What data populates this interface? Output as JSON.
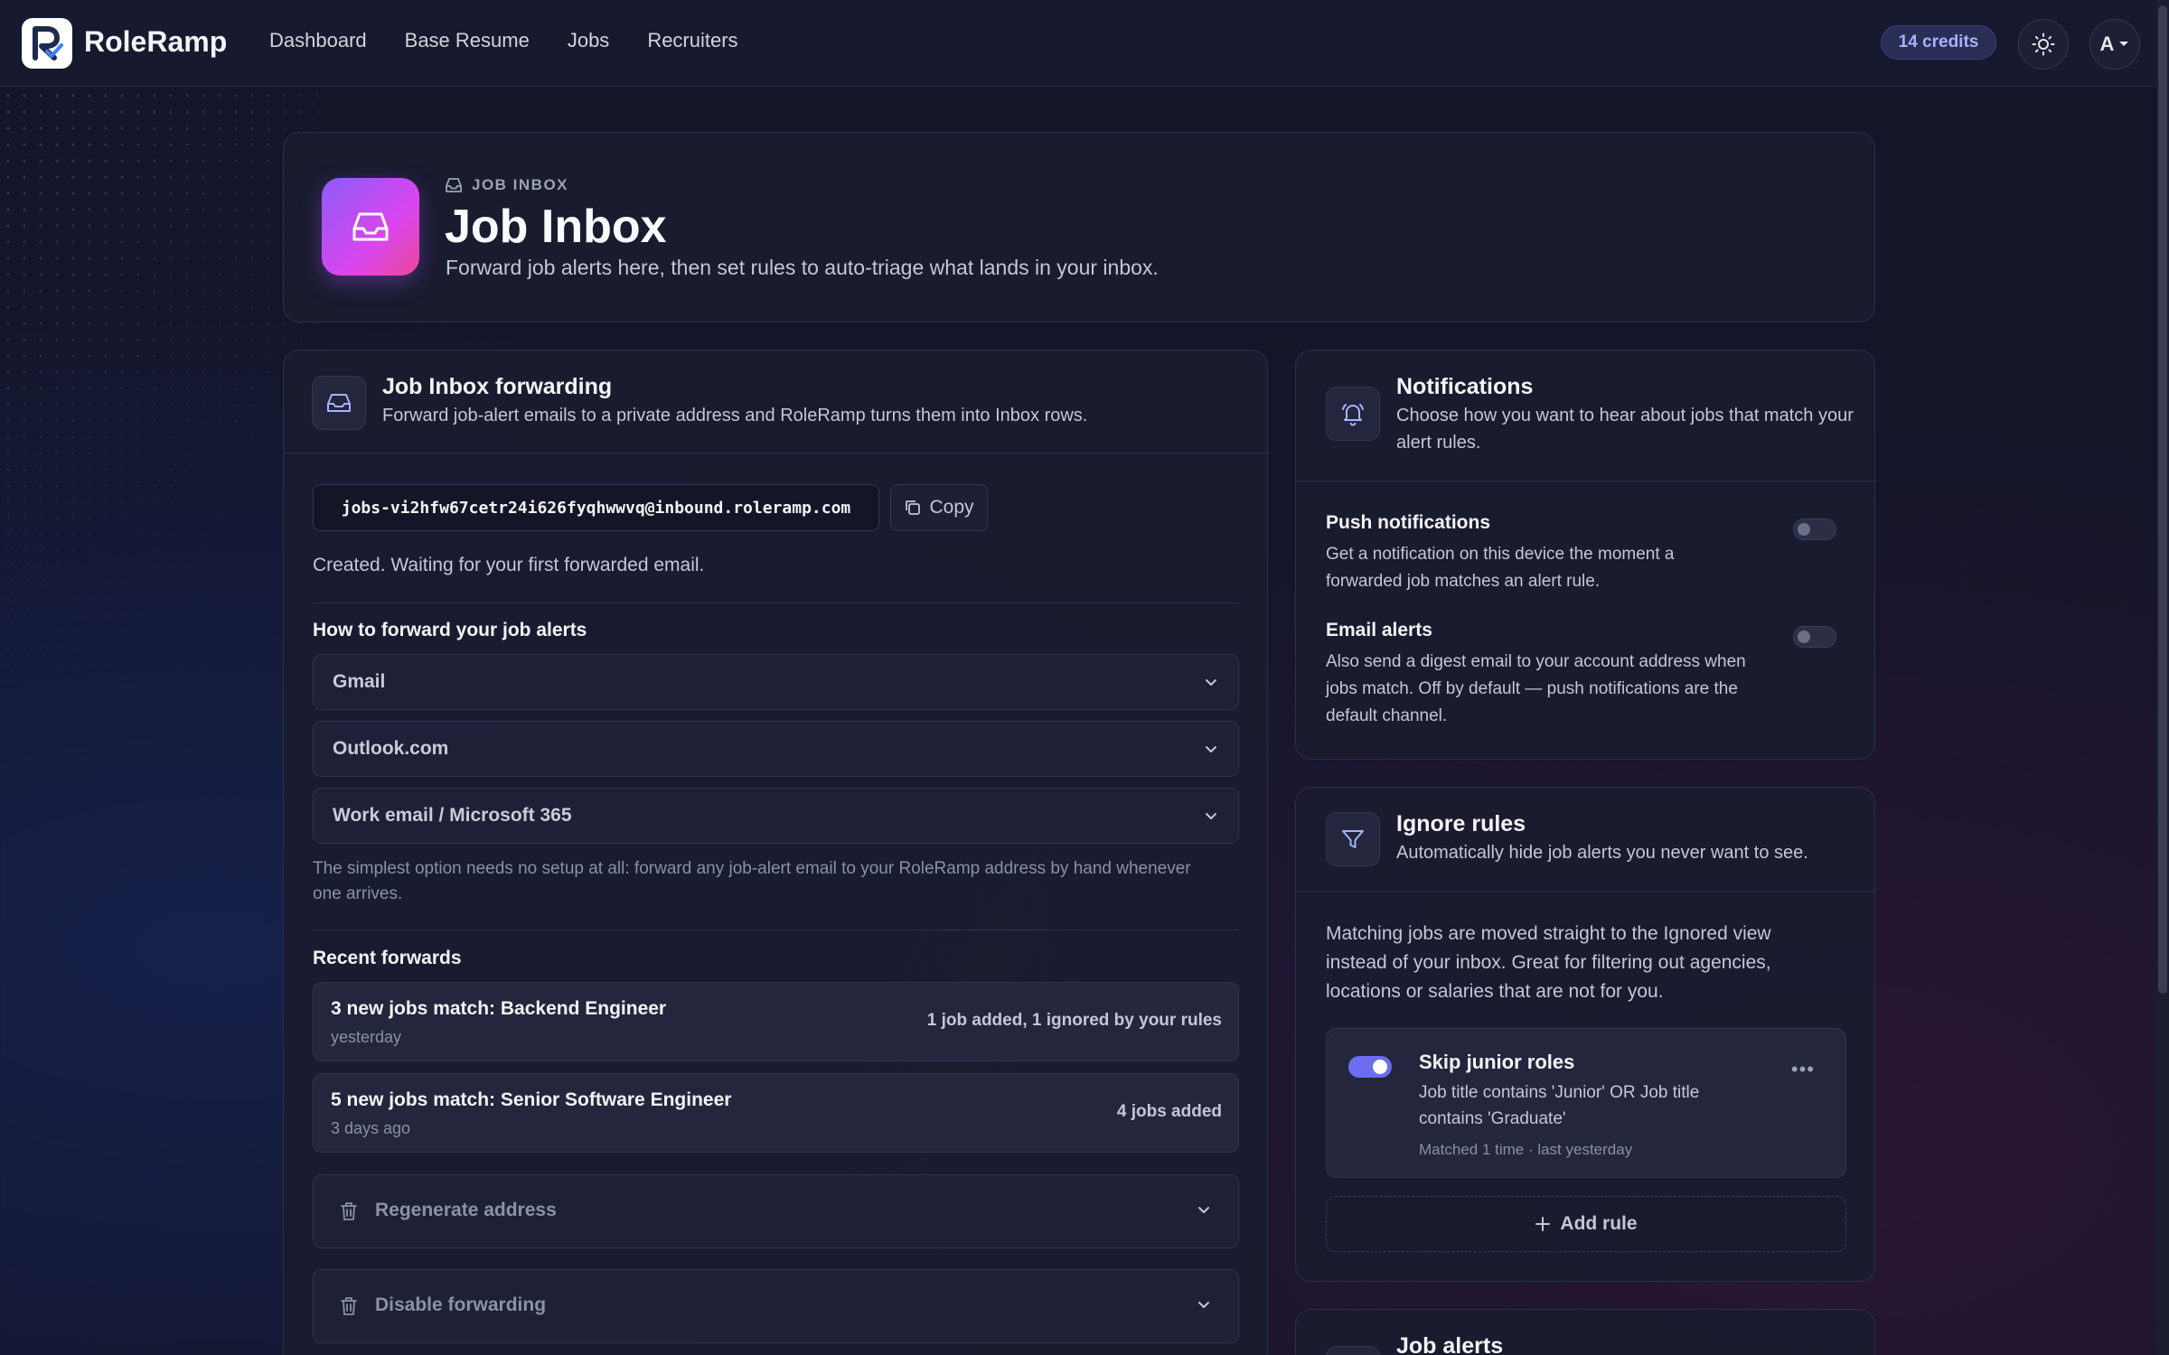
{
  "app": {
    "brand": "RoleRamp",
    "nav": [
      "Dashboard",
      "Base Resume",
      "Jobs",
      "Recruiters"
    ],
    "credits": "14 credits",
    "avatar_initial": "A"
  },
  "hero": {
    "eyebrow": "JOB INBOX",
    "title": "Job Inbox",
    "subtitle": "Forward job alerts here, then set rules to auto-triage what lands in your inbox."
  },
  "forwarding": {
    "title": "Job Inbox forwarding",
    "subtitle": "Forward job-alert emails to a private address and RoleRamp turns them into Inbox rows.",
    "address": "jobs-vi2hfw67cetr24i626fyqhwwvq@inbound.roleramp.com",
    "copy_label": "Copy",
    "status": "Created. Waiting for your first forwarded email.",
    "how_title": "How to forward your job alerts",
    "providers": [
      "Gmail",
      "Outlook.com",
      "Work email / Microsoft 365"
    ],
    "help": "The simplest option needs no setup at all: forward any job-alert email to your RoleRamp address by hand whenever one arrives.",
    "recent_title": "Recent forwards",
    "recent": [
      {
        "title": "3 new jobs match: Backend Engineer",
        "when": "yesterday",
        "result": "1 job added, 1 ignored by your rules"
      },
      {
        "title": "5 new jobs match: Senior Software Engineer",
        "when": "3 days ago",
        "result": "4 jobs added"
      }
    ],
    "regenerate_label": "Regenerate address",
    "disable_label": "Disable forwarding"
  },
  "notifications": {
    "title": "Notifications",
    "subtitle": "Choose how you want to hear about jobs that match your alert rules.",
    "push_title": "Push notifications",
    "push_desc": "Get a notification on this device the moment a forwarded job matches an alert rule.",
    "push_enabled": false,
    "email_title": "Email alerts",
    "email_desc": "Also send a digest email to your account address when jobs match. Off by default — push notifications are the default channel.",
    "email_enabled": false
  },
  "ignore_rules": {
    "title": "Ignore rules",
    "subtitle": "Automatically hide job alerts you never want to see.",
    "description": "Matching jobs are moved straight to the Ignored view instead of your inbox. Great for filtering out agencies, locations or salaries that are not for you.",
    "rules": [
      {
        "name": "Skip junior roles",
        "condition": "Job title contains 'Junior' OR Job title contains 'Graduate'",
        "meta": "Matched 1 time · last yesterday",
        "enabled": true
      }
    ],
    "add_label": "Add rule"
  },
  "job_alerts": {
    "title": "Job alerts"
  },
  "colors": {
    "accent": "#6d6df0",
    "hero_gradient_start": "#8b5cf6",
    "hero_gradient_end": "#ec4899",
    "credits_text": "#a5b4fc"
  }
}
